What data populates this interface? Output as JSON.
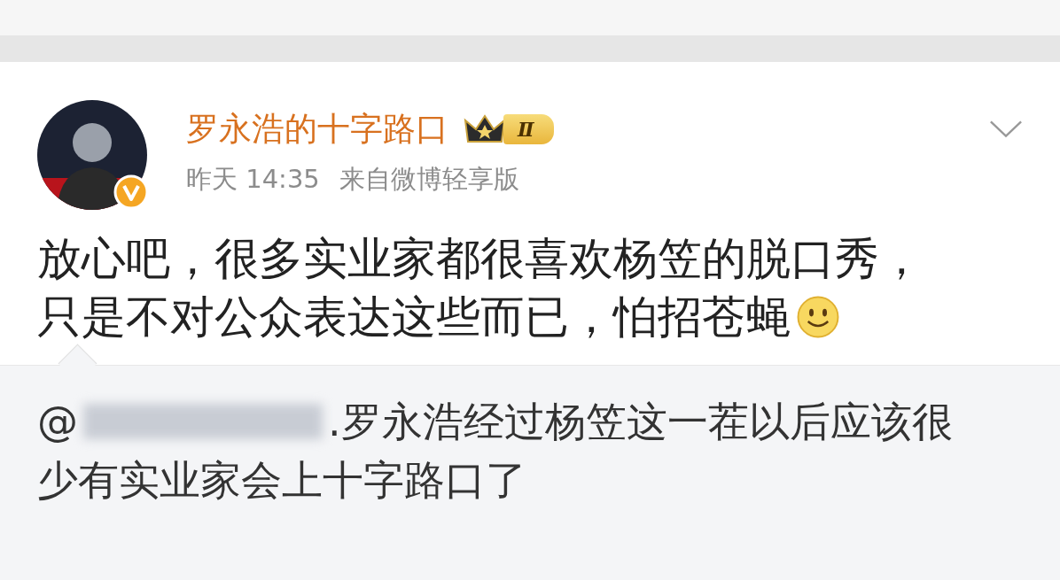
{
  "post": {
    "author": "罗永浩的十字路口",
    "level_badge": "Ⅱ",
    "verified": true,
    "time": "昨天 14:35",
    "source": "来自微博轻享版",
    "body": "放心吧，很多实业家都很喜欢杨笠的脱口秀，只是不对公众表达这些而已，怕招苍蝇"
  },
  "quote": {
    "mention_prefix": "@",
    "text_line1": ".罗永浩经过杨笠这一茬以后应该很",
    "text_line2": "少有实业家会上十字路口了"
  }
}
